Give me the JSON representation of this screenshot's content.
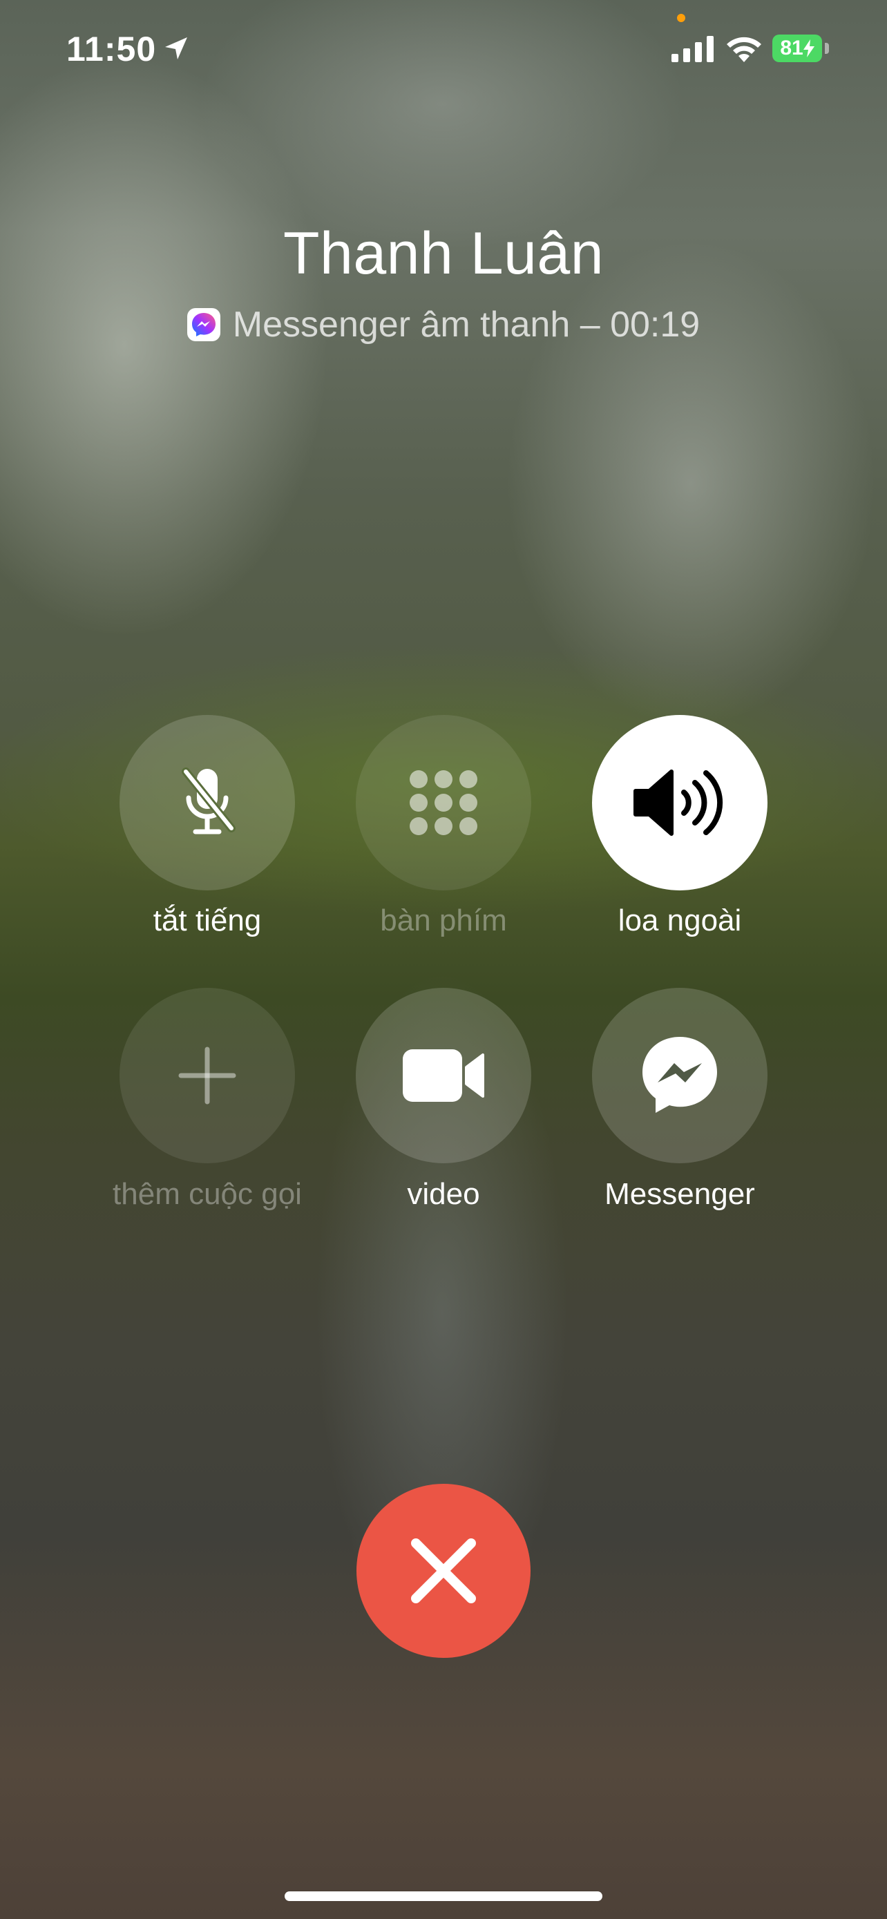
{
  "status_bar": {
    "time": "11:50",
    "battery": "81"
  },
  "call": {
    "caller_name": "Thanh Luân",
    "subtitle": "Messenger âm thanh – 00:19"
  },
  "controls": {
    "mute": {
      "label": "tắt tiếng",
      "icon": "mic-slash-icon"
    },
    "keypad": {
      "label": "bàn phím",
      "icon": "keypad-icon"
    },
    "speaker": {
      "label": "loa ngoài",
      "icon": "speaker-icon"
    },
    "add_call": {
      "label": "thêm cuộc gọi",
      "icon": "plus-icon"
    },
    "video": {
      "label": "video",
      "icon": "video-camera-icon"
    },
    "messenger": {
      "label": "Messenger",
      "icon": "messenger-icon"
    }
  },
  "colors": {
    "end_call": "#eb5545",
    "battery": "#4cd964",
    "speaker_active": "#ffffff"
  }
}
